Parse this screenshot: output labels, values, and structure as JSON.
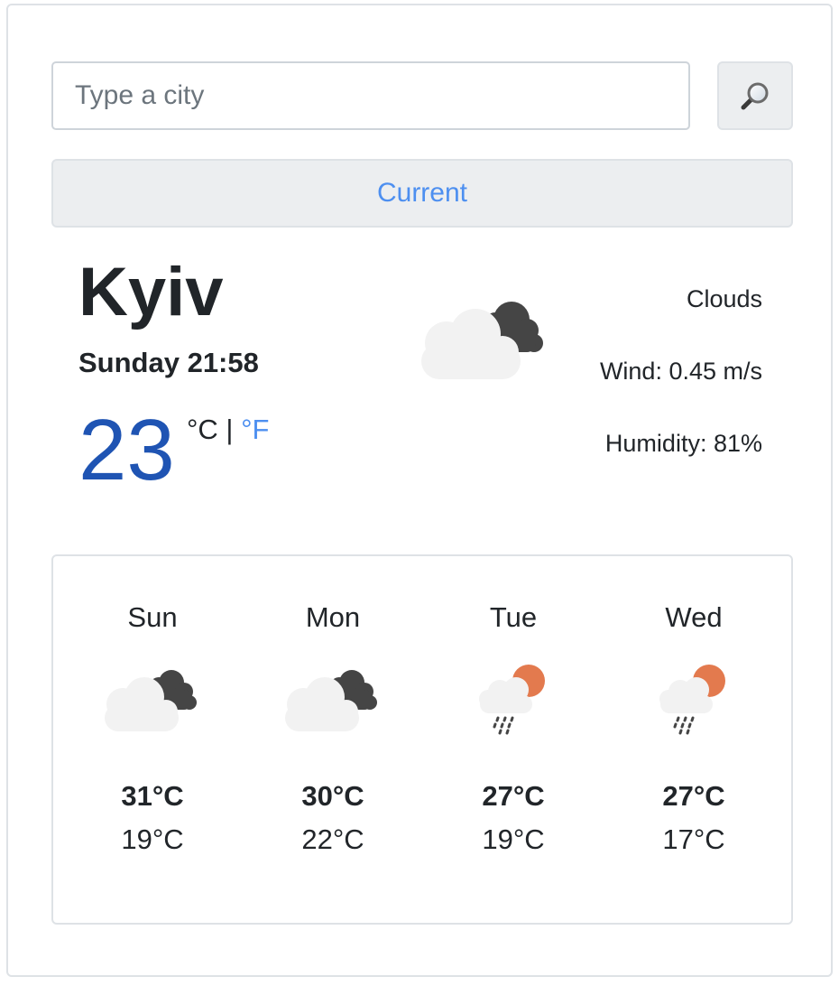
{
  "search": {
    "placeholder": "Type a city",
    "value": "",
    "button_icon": "magnifier-icon"
  },
  "current_button": {
    "label": "Current"
  },
  "current": {
    "city": "Kyiv",
    "datetime": "Sunday 21:58",
    "temperature": "23",
    "unit_celsius": "°C",
    "unit_separator": " | ",
    "unit_fahrenheit": "°F",
    "icon": "clouds-icon",
    "description": "Clouds",
    "wind": "Wind: 0.45 m/s",
    "humidity": "Humidity: 81%"
  },
  "forecast": [
    {
      "day": "Sun",
      "max": "31°C",
      "min": "19°C",
      "icon": "clouds-icon"
    },
    {
      "day": "Mon",
      "max": "30°C",
      "min": "22°C",
      "icon": "clouds-icon"
    },
    {
      "day": "Tue",
      "max": "27°C",
      "min": "19°C",
      "icon": "rain-sun-icon"
    },
    {
      "day": "Wed",
      "max": "27°C",
      "min": "17°C",
      "icon": "rain-sun-icon"
    }
  ],
  "colors": {
    "accent": "#4d8ff0",
    "temperature": "#1f54b3",
    "text": "#212529",
    "border": "#dee2e6",
    "button_bg": "#eceef0",
    "sun": "#e37a4e",
    "dark_cloud": "#454545",
    "light_cloud": "#f2f2f2"
  }
}
